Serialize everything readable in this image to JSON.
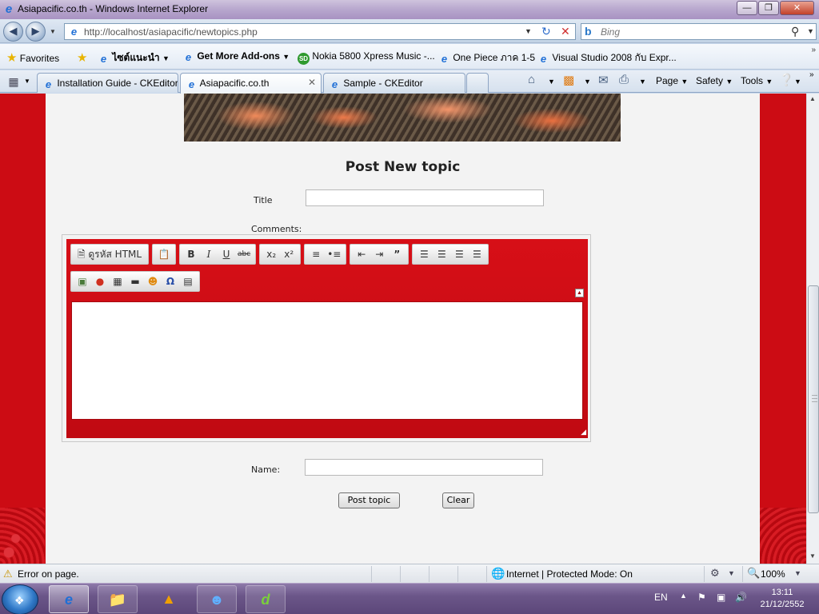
{
  "window": {
    "title": "Asiapacific.co.th - Windows Internet Explorer",
    "minimize_label": "—",
    "restore_label": "❐",
    "close_label": "✕"
  },
  "address": {
    "url": "http://localhost/asiapacific/newtopics.php",
    "search_placeholder": "Bing"
  },
  "favorites_bar": {
    "favorites_label": "Favorites",
    "items": [
      "ไซต์แนะนำ",
      "Get More Add-ons",
      "Nokia 5800 Xpress Music -...",
      "One Piece ภาค 1-5",
      "Visual Studio 2008 กับ Expr..."
    ]
  },
  "tabs": [
    {
      "label": "Installation Guide - CKEditor"
    },
    {
      "label": "Asiapacific.co.th"
    },
    {
      "label": "Sample - CKEditor"
    }
  ],
  "command_bar": {
    "page_label": "Page",
    "safety_label": "Safety",
    "tools_label": "Tools"
  },
  "form": {
    "heading": "Post New topic",
    "title_label": "Title",
    "comments_label": "Comments:",
    "name_label": "Name:",
    "post_button": "Post topic",
    "clear_button": "Clear"
  },
  "editor": {
    "source_label": "ดูรหัส HTML",
    "toolbar_icons": [
      "source-icon",
      "paste-icon",
      "bold-icon",
      "italic-icon",
      "underline-icon",
      "strikethrough-icon",
      "subscript-icon",
      "superscript-icon",
      "numbered-list-icon",
      "bulleted-list-icon",
      "outdent-icon",
      "indent-icon",
      "blockquote-icon",
      "align-left-icon",
      "align-center-icon",
      "align-right-icon",
      "justify-icon",
      "image-icon",
      "flash-icon",
      "table-icon",
      "horizontal-rule-icon",
      "smiley-icon",
      "special-char-icon",
      "page-break-icon"
    ]
  },
  "status_bar": {
    "error_text": "Error on page.",
    "zone_text": "Internet | Protected Mode: On",
    "zoom": "100%"
  },
  "taskbar": {
    "language": "EN",
    "time": "13:11",
    "date": "21/12/2552"
  },
  "colors": {
    "page_red": "#cc0c14",
    "editor_red": "#d70f17",
    "page_bg": "#f3f3f3"
  }
}
